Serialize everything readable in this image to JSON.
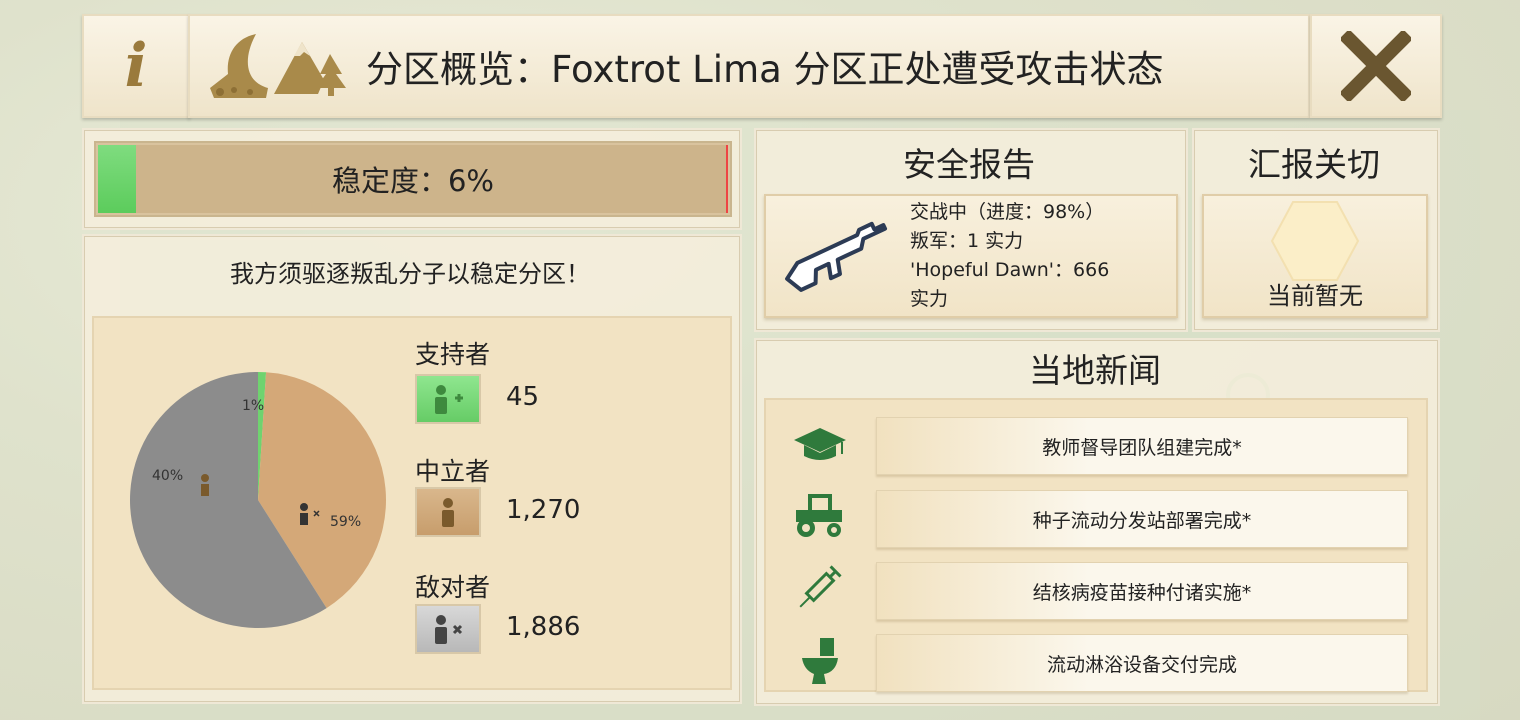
{
  "header": {
    "info_label": "i",
    "title": "分区概览：Foxtrot Lima 分区正处遭受攻击状态",
    "close_label": "✕"
  },
  "stability": {
    "label": "稳定度：6%",
    "value": 0.06
  },
  "notice": "我方须驱逐叛乱分子以稳定分区！",
  "pie": {
    "slices": [
      {
        "name": "supporters",
        "percent": 1,
        "label": "1%",
        "color": "#6fd36f"
      },
      {
        "name": "neutral",
        "percent": 40,
        "label": "40%",
        "color": "#d4a878"
      },
      {
        "name": "hostile",
        "percent": 59,
        "label": "59%",
        "color": "#8c8c8c"
      }
    ]
  },
  "legend": {
    "supporters": {
      "title": "支持者",
      "value": "45"
    },
    "neutral": {
      "title": "中立者",
      "value": "1,270"
    },
    "hostile": {
      "title": "敌对者",
      "value": "1,886"
    }
  },
  "security": {
    "title": "安全报告",
    "line1": "交战中（进度：98%）",
    "line2": "叛军：1 实力",
    "line3": "'Hopeful Dawn'：666",
    "line4": "实力"
  },
  "concerns": {
    "title": "汇报关切",
    "status": "当前暂无"
  },
  "news": {
    "title": "当地新闻",
    "items": [
      {
        "icon": "graduation-cap-icon",
        "text": "教师督导团队组建完成*"
      },
      {
        "icon": "tractor-icon",
        "text": "种子流动分发站部署完成*"
      },
      {
        "icon": "syringe-icon",
        "text": "结核病疫苗接种付诸实施*"
      },
      {
        "icon": "toilet-icon",
        "text": "流动淋浴设备交付完成"
      }
    ]
  },
  "colors": {
    "accent_gold": "#9a7a3c",
    "green": "#6fd36f",
    "beige": "#cdb48b"
  }
}
